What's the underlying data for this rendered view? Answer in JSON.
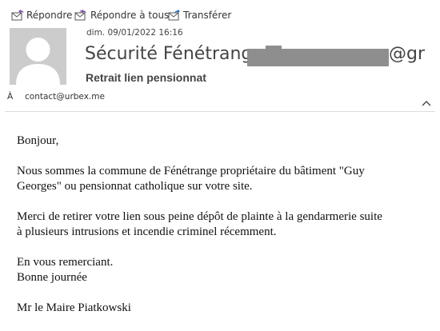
{
  "toolbar": {
    "reply_label": "Répondre",
    "reply_all_label": "Répondre à tous",
    "forward_label": "Transférer",
    "icon_reply": "reply-icon",
    "icon_reply_all": "reply-all-icon",
    "icon_forward": "forward-icon"
  },
  "message": {
    "date": "dim. 09/01/2022 16:16",
    "sender_name": "Sécurité Fénétrange <",
    "sender_domain_visible": "@gr",
    "subject": "Retrait lien pensionnat",
    "to_label": "À",
    "to_address": "contact@urbex.me"
  },
  "body": {
    "greeting": "Bonjour,",
    "p1_l1": "Nous sommes la commune de Fénétrange propriétaire du bâtiment \"Guy",
    "p1_l2": "Georges\" ou pensionnat catholique sur votre site.",
    "p2_l1": "Merci de retirer votre lien sous peine dépôt de plainte à la gendarmerie suite",
    "p2_l2": "à plusieurs intrusions et incendie criminel récemment.",
    "closing_l1": "En vous remerciant.",
    "closing_l2": "Bonne journée",
    "signature": "Mr le Maire Piatkowski"
  },
  "colors": {
    "icon_blue": "#2b6cb0",
    "icon_purple": "#7a4fa3",
    "avatar_bg": "#cccccc",
    "redaction": "#8e8e8e"
  }
}
